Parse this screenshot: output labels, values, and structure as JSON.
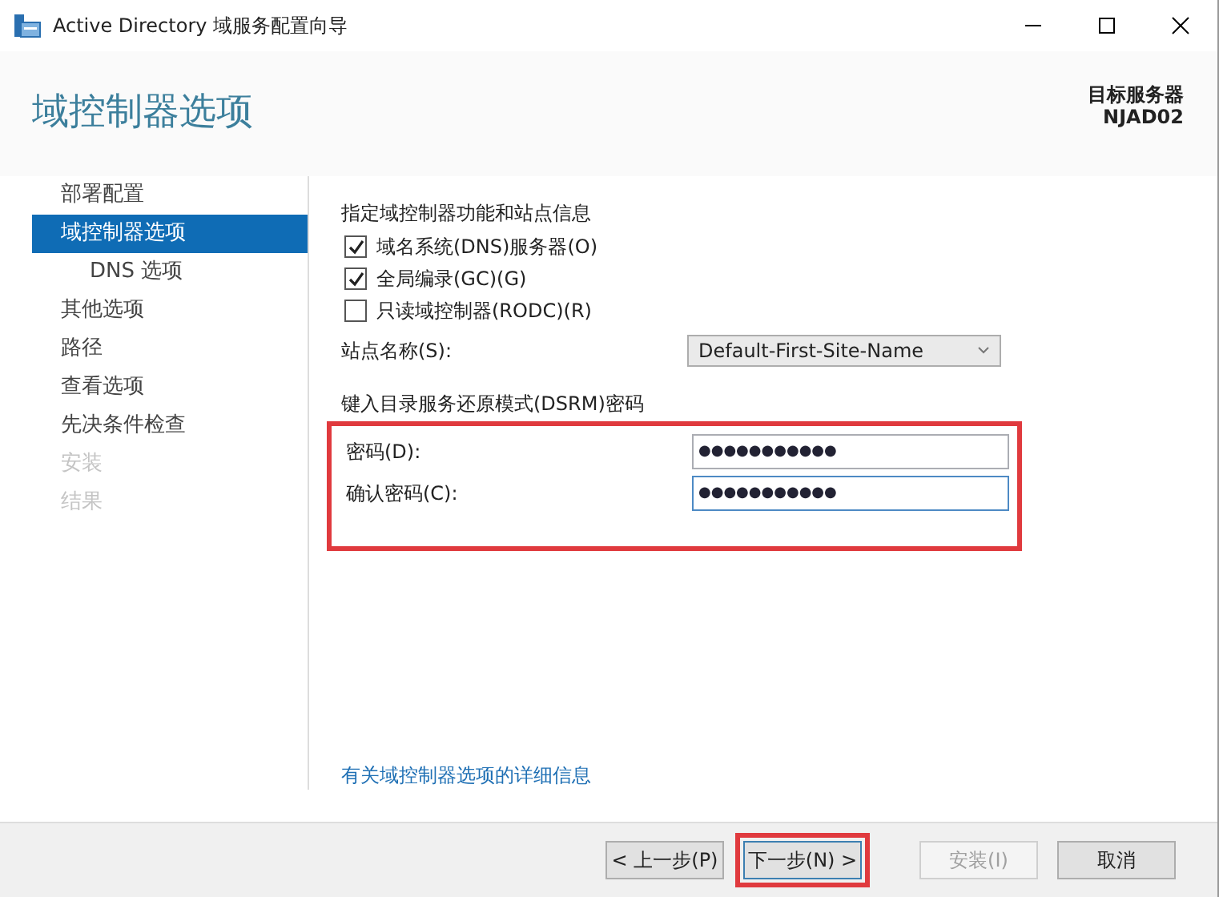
{
  "window": {
    "title": "Active Directory 域服务配置向导"
  },
  "header": {
    "title": "域控制器选项",
    "target_label": "目标服务器",
    "target_server": "NJAD02"
  },
  "sidebar": {
    "items": [
      {
        "label": "部署配置",
        "selected": false,
        "disabled": false
      },
      {
        "label": "域控制器选项",
        "selected": true,
        "disabled": false,
        "children": [
          {
            "label": "DNS 选项",
            "selected": false,
            "disabled": false
          }
        ]
      },
      {
        "label": "其他选项",
        "selected": false,
        "disabled": false
      },
      {
        "label": "路径",
        "selected": false,
        "disabled": false
      },
      {
        "label": "查看选项",
        "selected": false,
        "disabled": false
      },
      {
        "label": "先决条件检查",
        "selected": false,
        "disabled": false
      },
      {
        "label": "安装",
        "selected": false,
        "disabled": true
      },
      {
        "label": "结果",
        "selected": false,
        "disabled": true
      }
    ]
  },
  "content": {
    "section_title": "指定域控制器功能和站点信息",
    "checkboxes": [
      {
        "label": "域名系统(DNS)服务器(O)",
        "checked": true
      },
      {
        "label": "全局编录(GC)(G)",
        "checked": true
      },
      {
        "label": "只读域控制器(RODC)(R)",
        "checked": false
      }
    ],
    "site_label": "站点名称(S):",
    "site_value": "Default-First-Site-Name",
    "password_title": "键入目录服务还原模式(DSRM)密码",
    "password_highlighted": true,
    "password_fields": [
      {
        "label": "密码(D):",
        "value": "●●●●●●●●●●●",
        "focused": false
      },
      {
        "label": "确认密码(C):",
        "value": "●●●●●●●●●●●",
        "focused": true
      }
    ],
    "more_link": "有关域控制器选项的详细信息"
  },
  "buttons": [
    {
      "label": "< 上一步(P)",
      "disabled": false,
      "highlighted": false
    },
    {
      "label": "下一步(N) >",
      "disabled": false,
      "highlighted": true
    },
    {
      "label": "安装(I)",
      "disabled": true,
      "highlighted": false
    },
    {
      "label": "取消",
      "disabled": false,
      "highlighted": false
    }
  ]
}
